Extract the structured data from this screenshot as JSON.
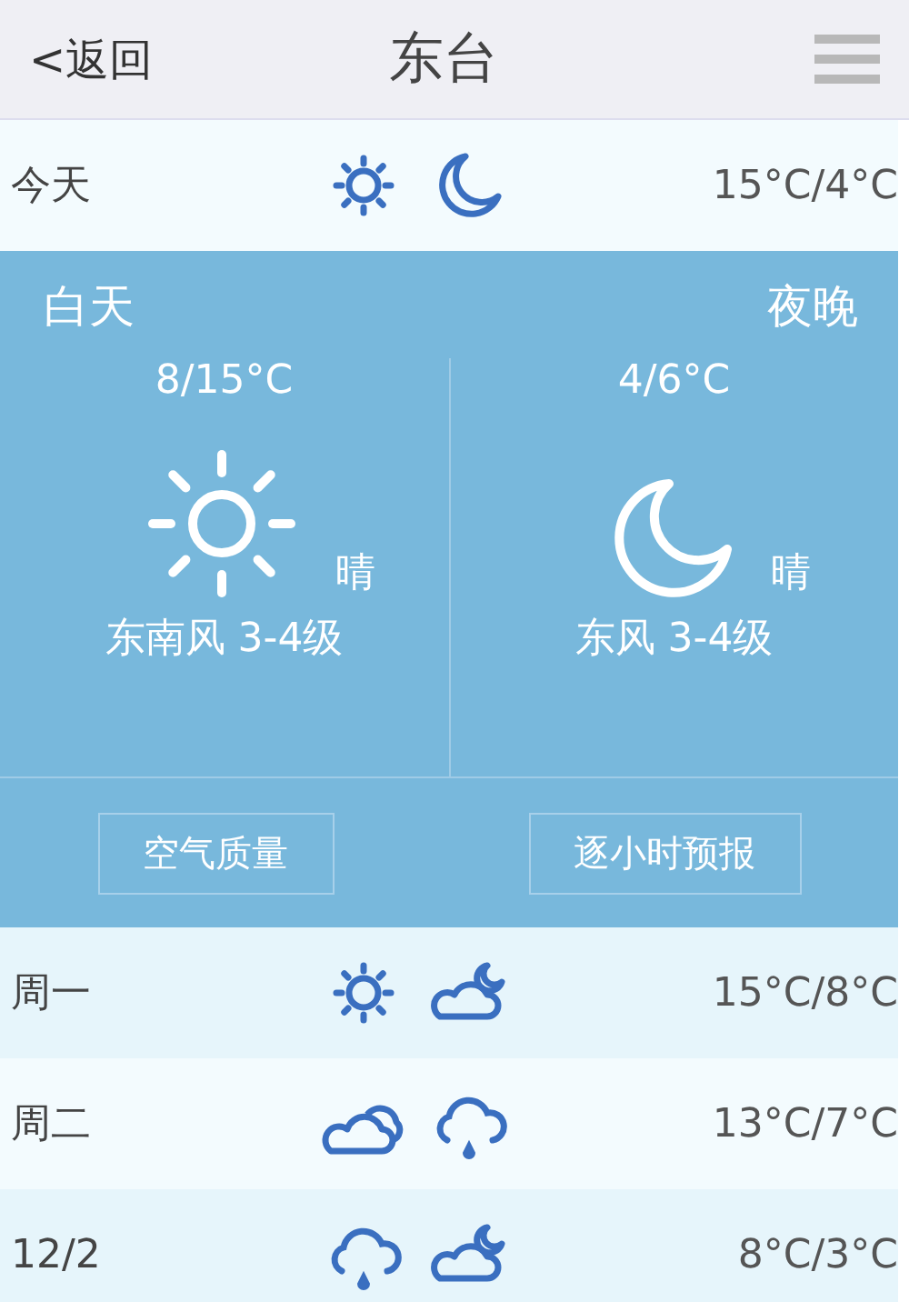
{
  "header": {
    "back": "<返回",
    "title": "东台"
  },
  "today": {
    "label": "今天",
    "icons": [
      {
        "kind": "sun"
      },
      {
        "kind": "moon"
      }
    ],
    "temp": "15°C/4°C"
  },
  "detail": {
    "day_label": "白天",
    "night_label": "夜晚",
    "day": {
      "temp": "8/15°C",
      "kind": "sun",
      "weather": "晴",
      "wind": "东南风 3-4级"
    },
    "night": {
      "temp": "4/6°C",
      "kind": "moon",
      "weather": "晴",
      "wind": "东风 3-4级"
    },
    "buttons": [
      "空气质量",
      "逐小时预报"
    ]
  },
  "forecast": [
    {
      "label": "周一",
      "icons": [
        {
          "kind": "sun"
        },
        {
          "kind": "cloud-moon"
        }
      ],
      "temp": "15°C/8°C"
    },
    {
      "label": "周二",
      "icons": [
        {
          "kind": "clouds"
        },
        {
          "kind": "rain"
        }
      ],
      "temp": "13°C/7°C"
    },
    {
      "label": "12/2",
      "icons": [
        {
          "kind": "rain"
        },
        {
          "kind": "cloud-moon"
        }
      ],
      "temp": "8°C/3°C"
    }
  ]
}
